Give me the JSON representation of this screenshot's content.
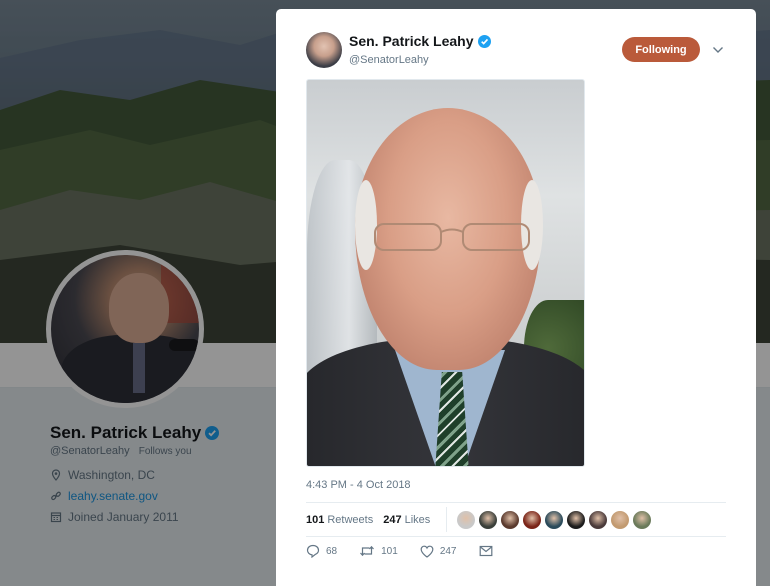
{
  "profile": {
    "name": "Sen. Patrick Leahy",
    "handle": "@SenatorLeahy",
    "follows_you": "Follows you",
    "location": "Washington, DC",
    "website": "leahy.senate.gov",
    "joined": "Joined January 2011"
  },
  "tweet": {
    "author_name": "Sen. Patrick Leahy",
    "author_handle": "@SenatorLeahy",
    "follow_label": "Following",
    "timestamp": "4:43 PM - 4 Oct 2018",
    "retweets_count": "101",
    "retweets_label": "Retweets",
    "likes_count": "247",
    "likes_label": "Likes",
    "reply_count": "68",
    "retweet_action_count": "101",
    "like_action_count": "247"
  },
  "colors": {
    "following_button": "#ba5a3a",
    "verified_badge": "#1da1f2",
    "link": "#1b95e0",
    "muted_text": "#657786"
  },
  "likers": [
    "#c9c9c9",
    "#3a3f3a",
    "#5b3a2e",
    "#7a2418",
    "#2a4a5a",
    "#1c1c1c",
    "#4a3a3a",
    "#c29a70",
    "#6a7a5a"
  ]
}
